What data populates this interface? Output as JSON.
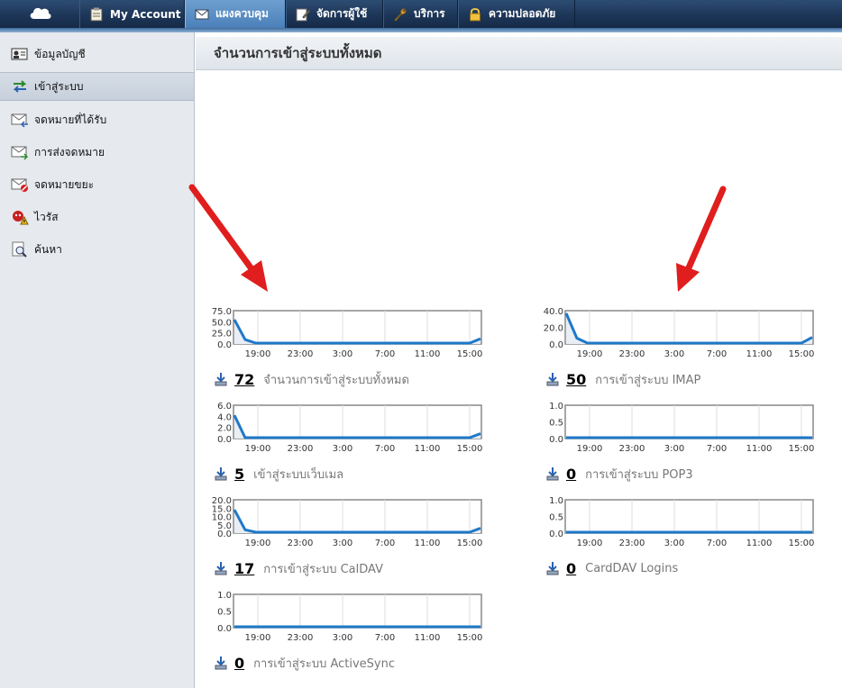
{
  "nav": {
    "tabs": [
      {
        "label": "My Account",
        "icon": "clipboard-icon",
        "active": false
      },
      {
        "label": "แผงควบคุม",
        "icon": "envelope-icon",
        "active": true
      },
      {
        "label": "จัดการผู้ใช้",
        "icon": "pencil-icon",
        "active": false
      },
      {
        "label": "บริการ",
        "icon": "wrench-icon",
        "active": false
      },
      {
        "label": "ความปลอดภัย",
        "icon": "lock-icon",
        "active": false
      }
    ]
  },
  "sidebar": {
    "items": [
      {
        "label": "ข้อมูลบัญชี",
        "icon": "account-card-icon"
      },
      {
        "label": "เข้าสู่ระบบ",
        "icon": "login-arrows-icon",
        "active": true
      },
      {
        "label": "จดหมายที่ได้รับ",
        "icon": "mail-received-icon"
      },
      {
        "label": "การส่งจดหมาย",
        "icon": "mail-sent-icon"
      },
      {
        "label": "จดหมายขยะ",
        "icon": "mail-spam-icon"
      },
      {
        "label": "ไวรัส",
        "icon": "virus-icon"
      },
      {
        "label": "ค้นหา",
        "icon": "search-icon"
      }
    ]
  },
  "header": {
    "title": "จำนวนการเข้าสู่ระบบทั้งหมด"
  },
  "colors": {
    "line": "#1f78c8",
    "fill": "#e9eef4",
    "axis": "#888888",
    "grid": "#dcdcdc"
  },
  "stats": [
    {
      "count": "72",
      "label": "จำนวนการเข้าสู่ระบบทั้งหมด"
    },
    {
      "count": "50",
      "label": "การเข้าสู่ระบบ IMAP"
    },
    {
      "count": "5",
      "label": "เข้าสู่ระบบเว็บเมล"
    },
    {
      "count": "0",
      "label": "การเข้าสู่ระบบ POP3"
    },
    {
      "count": "17",
      "label": "การเข้าสู่ระบบ CalDAV"
    },
    {
      "count": "0",
      "label": "CardDAV Logins"
    },
    {
      "count": "0",
      "label": "การเข้าสู่ระบบ ActiveSync"
    }
  ],
  "chart_data": [
    {
      "type": "line",
      "series_name": "total",
      "x_ticks": [
        "19:00",
        "23:00",
        "3:00",
        "7:00",
        "11:00",
        "15:00"
      ],
      "y_ticks": [
        "75.0",
        "50.0",
        "25.0",
        "0.0"
      ],
      "ylim": [
        0,
        75
      ],
      "values": [
        55,
        10,
        1,
        0,
        0,
        0,
        0,
        0,
        0,
        0,
        0,
        0,
        0,
        0,
        0,
        0,
        0,
        0,
        0,
        0,
        0,
        0,
        2,
        12
      ]
    },
    {
      "type": "line",
      "series_name": "imap",
      "x_ticks": [
        "19:00",
        "23:00",
        "3:00",
        "7:00",
        "11:00",
        "15:00"
      ],
      "y_ticks": [
        "40.0",
        "20.0",
        "0.0"
      ],
      "ylim": [
        0,
        40
      ],
      "values": [
        37,
        7,
        0,
        0,
        0,
        0,
        0,
        0,
        0,
        0,
        0,
        0,
        0,
        0,
        0,
        0,
        0,
        0,
        0,
        0,
        0,
        0,
        1,
        8
      ]
    },
    {
      "type": "line",
      "series_name": "webmail",
      "x_ticks": [
        "19:00",
        "23:00",
        "3:00",
        "7:00",
        "11:00",
        "15:00"
      ],
      "y_ticks": [
        "6.0",
        "4.0",
        "2.0",
        "0.0"
      ],
      "ylim": [
        0,
        6
      ],
      "values": [
        4.2,
        0,
        0,
        0,
        0,
        0,
        0,
        0,
        0,
        0,
        0,
        0,
        0,
        0,
        0,
        0,
        0,
        0,
        0,
        0,
        0,
        0,
        0,
        0.9
      ]
    },
    {
      "type": "line",
      "series_name": "pop3",
      "x_ticks": [
        "19:00",
        "23:00",
        "3:00",
        "7:00",
        "11:00",
        "15:00"
      ],
      "y_ticks": [
        "1.0",
        "0.5",
        "0.0"
      ],
      "ylim": [
        0,
        1
      ],
      "values": [
        0,
        0,
        0,
        0,
        0,
        0,
        0,
        0,
        0,
        0,
        0,
        0,
        0,
        0,
        0,
        0,
        0,
        0,
        0,
        0,
        0,
        0,
        0,
        0
      ]
    },
    {
      "type": "line",
      "series_name": "caldav",
      "x_ticks": [
        "19:00",
        "23:00",
        "3:00",
        "7:00",
        "11:00",
        "15:00"
      ],
      "y_ticks": [
        "20.0",
        "15.0",
        "10.0",
        "5.0",
        "0.0"
      ],
      "ylim": [
        0,
        20
      ],
      "values": [
        14,
        2,
        0.5,
        0,
        0,
        0,
        0,
        0,
        0,
        0,
        0,
        0,
        0,
        0,
        0,
        0,
        0,
        0,
        0,
        0,
        0,
        0,
        0.5,
        3
      ]
    },
    {
      "type": "line",
      "series_name": "carddav",
      "x_ticks": [
        "19:00",
        "23:00",
        "3:00",
        "7:00",
        "11:00",
        "15:00"
      ],
      "y_ticks": [
        "1.0",
        "0.5",
        "0.0"
      ],
      "ylim": [
        0,
        1
      ],
      "values": [
        0,
        0,
        0,
        0,
        0,
        0,
        0,
        0,
        0,
        0,
        0,
        0,
        0,
        0,
        0,
        0,
        0,
        0,
        0,
        0,
        0,
        0,
        0,
        0
      ]
    },
    {
      "type": "line",
      "series_name": "activesync",
      "x_ticks": [
        "19:00",
        "23:00",
        "3:00",
        "7:00",
        "11:00",
        "15:00"
      ],
      "y_ticks": [
        "1.0",
        "0.5",
        "0.0"
      ],
      "ylim": [
        0,
        1
      ],
      "values": [
        0,
        0,
        0,
        0,
        0,
        0,
        0,
        0,
        0,
        0,
        0,
        0,
        0,
        0,
        0,
        0,
        0,
        0,
        0,
        0,
        0,
        0,
        0,
        0
      ]
    }
  ]
}
